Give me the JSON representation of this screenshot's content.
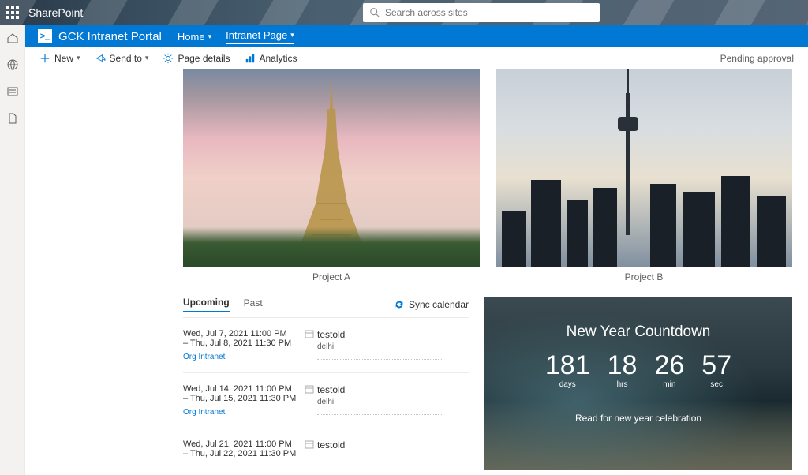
{
  "suite": {
    "name": "SharePoint",
    "search_placeholder": "Search across sites"
  },
  "site": {
    "title": "GCK Intranet Portal",
    "nav": [
      {
        "label": "Home",
        "active": false
      },
      {
        "label": "Intranet Page",
        "active": true
      }
    ]
  },
  "commandbar": {
    "new": "New",
    "send_to": "Send to",
    "page_details": "Page details",
    "analytics": "Analytics",
    "status": "Pending approval"
  },
  "gallery": [
    {
      "caption": "Project A"
    },
    {
      "caption": "Project B"
    }
  ],
  "events": {
    "tabs": {
      "upcoming": "Upcoming",
      "past": "Past"
    },
    "sync_label": "Sync calendar",
    "items": [
      {
        "line1": "Wed, Jul 7, 2021 11:00 PM",
        "line2": "– Thu, Jul 8, 2021 11:30 PM",
        "src": "Org Intranet",
        "title": "testold",
        "loc": "delhi"
      },
      {
        "line1": "Wed, Jul 14, 2021 11:00 PM",
        "line2": "– Thu, Jul 15, 2021 11:30 PM",
        "src": "Org Intranet",
        "title": "testold",
        "loc": "delhi"
      },
      {
        "line1": "Wed, Jul 21, 2021 11:00 PM",
        "line2": "– Thu, Jul 22, 2021 11:30 PM",
        "src": "",
        "title": "testold",
        "loc": ""
      }
    ]
  },
  "countdown": {
    "title": "New Year Countdown",
    "days": "181",
    "hrs": "18",
    "min": "26",
    "sec": "57",
    "labels": {
      "days": "days",
      "hrs": "hrs",
      "min": "min",
      "sec": "sec"
    },
    "subtitle": "Read for new year celebration"
  }
}
